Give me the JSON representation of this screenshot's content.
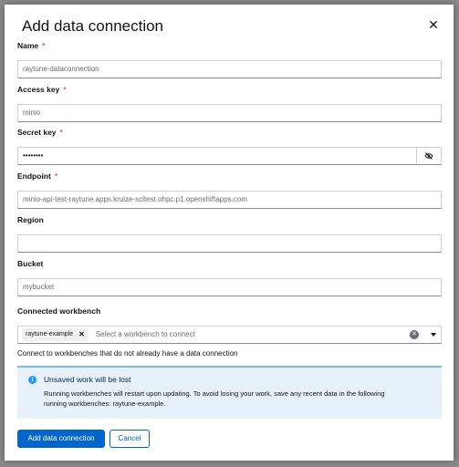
{
  "modal": {
    "title": "Add data connection",
    "close_icon": "close-icon"
  },
  "fields": {
    "name": {
      "label": "Name",
      "required": "*",
      "value": "raytune-dataconnection"
    },
    "access_key": {
      "label": "Access key",
      "required": "*",
      "value": "minio"
    },
    "secret_key": {
      "label": "Secret key",
      "required": "*",
      "value": "••••••••",
      "toggle_icon": "eye-slash-icon"
    },
    "endpoint": {
      "label": "Endpoint",
      "required": "*",
      "value": "minio-api-test-raytune.apps.kruize-scltest.ohpc.p1.openshiftapps.com"
    },
    "region": {
      "label": "Region",
      "value": ""
    },
    "bucket": {
      "label": "Bucket",
      "value": "mybucket"
    },
    "workbench": {
      "label": "Connected workbench",
      "chip": "raytune-example",
      "chip_remove": "✕",
      "placeholder": "Select a workbench to connect",
      "helper": "Connect to workbenches that do not already have a data connection"
    }
  },
  "alert": {
    "icon": "info-icon",
    "title": "Unsaved work will be lost",
    "body_line1": "Running workbenches will restart upon updating. To avoid losing your work, save any recent data in the following",
    "body_line2": "running workbenches: raytune-example."
  },
  "buttons": {
    "submit": "Add data connection",
    "cancel": "Cancel"
  },
  "colors": {
    "primary": "#0066cc",
    "required": "#c9190b",
    "alert_bg": "#e7f1fa",
    "alert_border": "#73bcf7",
    "info": "#2b9af3"
  }
}
